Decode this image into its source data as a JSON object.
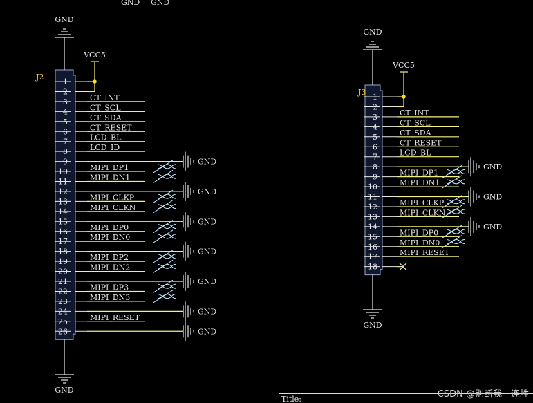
{
  "top_labels": [
    "GND",
    "GND"
  ],
  "watermark": "CSDN @别断我一连胜",
  "title_block": {
    "title": "Title:"
  },
  "colors": {
    "wire": "#f5f07a",
    "ground": "#e8e8e8",
    "body": "#101830",
    "junction": "#ffe000"
  },
  "j2": {
    "ref": "J2",
    "vcc": "VCC5",
    "gnd_top": "GND",
    "gnd_bottom": "GND",
    "pins": [
      "1",
      "2",
      "3",
      "4",
      "5",
      "6",
      "7",
      "8",
      "9",
      "10",
      "11",
      "12",
      "13",
      "14",
      "15",
      "16",
      "17",
      "18",
      "19",
      "20",
      "21",
      "22",
      "23",
      "24",
      "25",
      "26"
    ],
    "nets": {
      "3": "CT_INT",
      "4": "CT_SCL",
      "5": "CT_SDA",
      "6": "CT_RESET",
      "7": "LCD_BL",
      "8": "LCD_ID",
      "10": "MIPI_DP1",
      "11": "MIPI_DN1",
      "13": "MIPI_CLKP",
      "14": "MIPI_CLKN",
      "16": "MIPI_DP0",
      "17": "MIPI_DN0",
      "19": "MIPI_DP2",
      "20": "MIPI_DN2",
      "22": "MIPI_DP3",
      "23": "MIPI_DN3",
      "25": "MIPI_RESET"
    },
    "gnd_pins": [
      "9",
      "12",
      "15",
      "18",
      "21",
      "24",
      "26"
    ],
    "gnd_symbol_label": "GND"
  },
  "j3": {
    "ref": "J3",
    "vcc": "VCC5",
    "gnd_top": "GND",
    "gnd_bottom": "GND",
    "pins": [
      "1",
      "2",
      "3",
      "4",
      "5",
      "6",
      "7",
      "8",
      "9",
      "10",
      "11",
      "12",
      "13",
      "14",
      "15",
      "16",
      "17",
      "18"
    ],
    "nets": {
      "3": "CT_INT",
      "4": "CT_SCL",
      "5": "CT_SDA",
      "6": "CT_RESET",
      "7": "LCD_BL",
      "9": "MIPI_DP1",
      "10": "MIPI_DN1",
      "12": "MIPI_CLKP",
      "13": "MIPI_CLKN",
      "15": "MIPI_DP0",
      "16": "MIPI_DN0",
      "17": "MIPI_RESET"
    },
    "gnd_pins": [
      "8",
      "11",
      "14"
    ],
    "nc_pins": [
      "18"
    ],
    "gnd_symbol_label": "GND"
  }
}
